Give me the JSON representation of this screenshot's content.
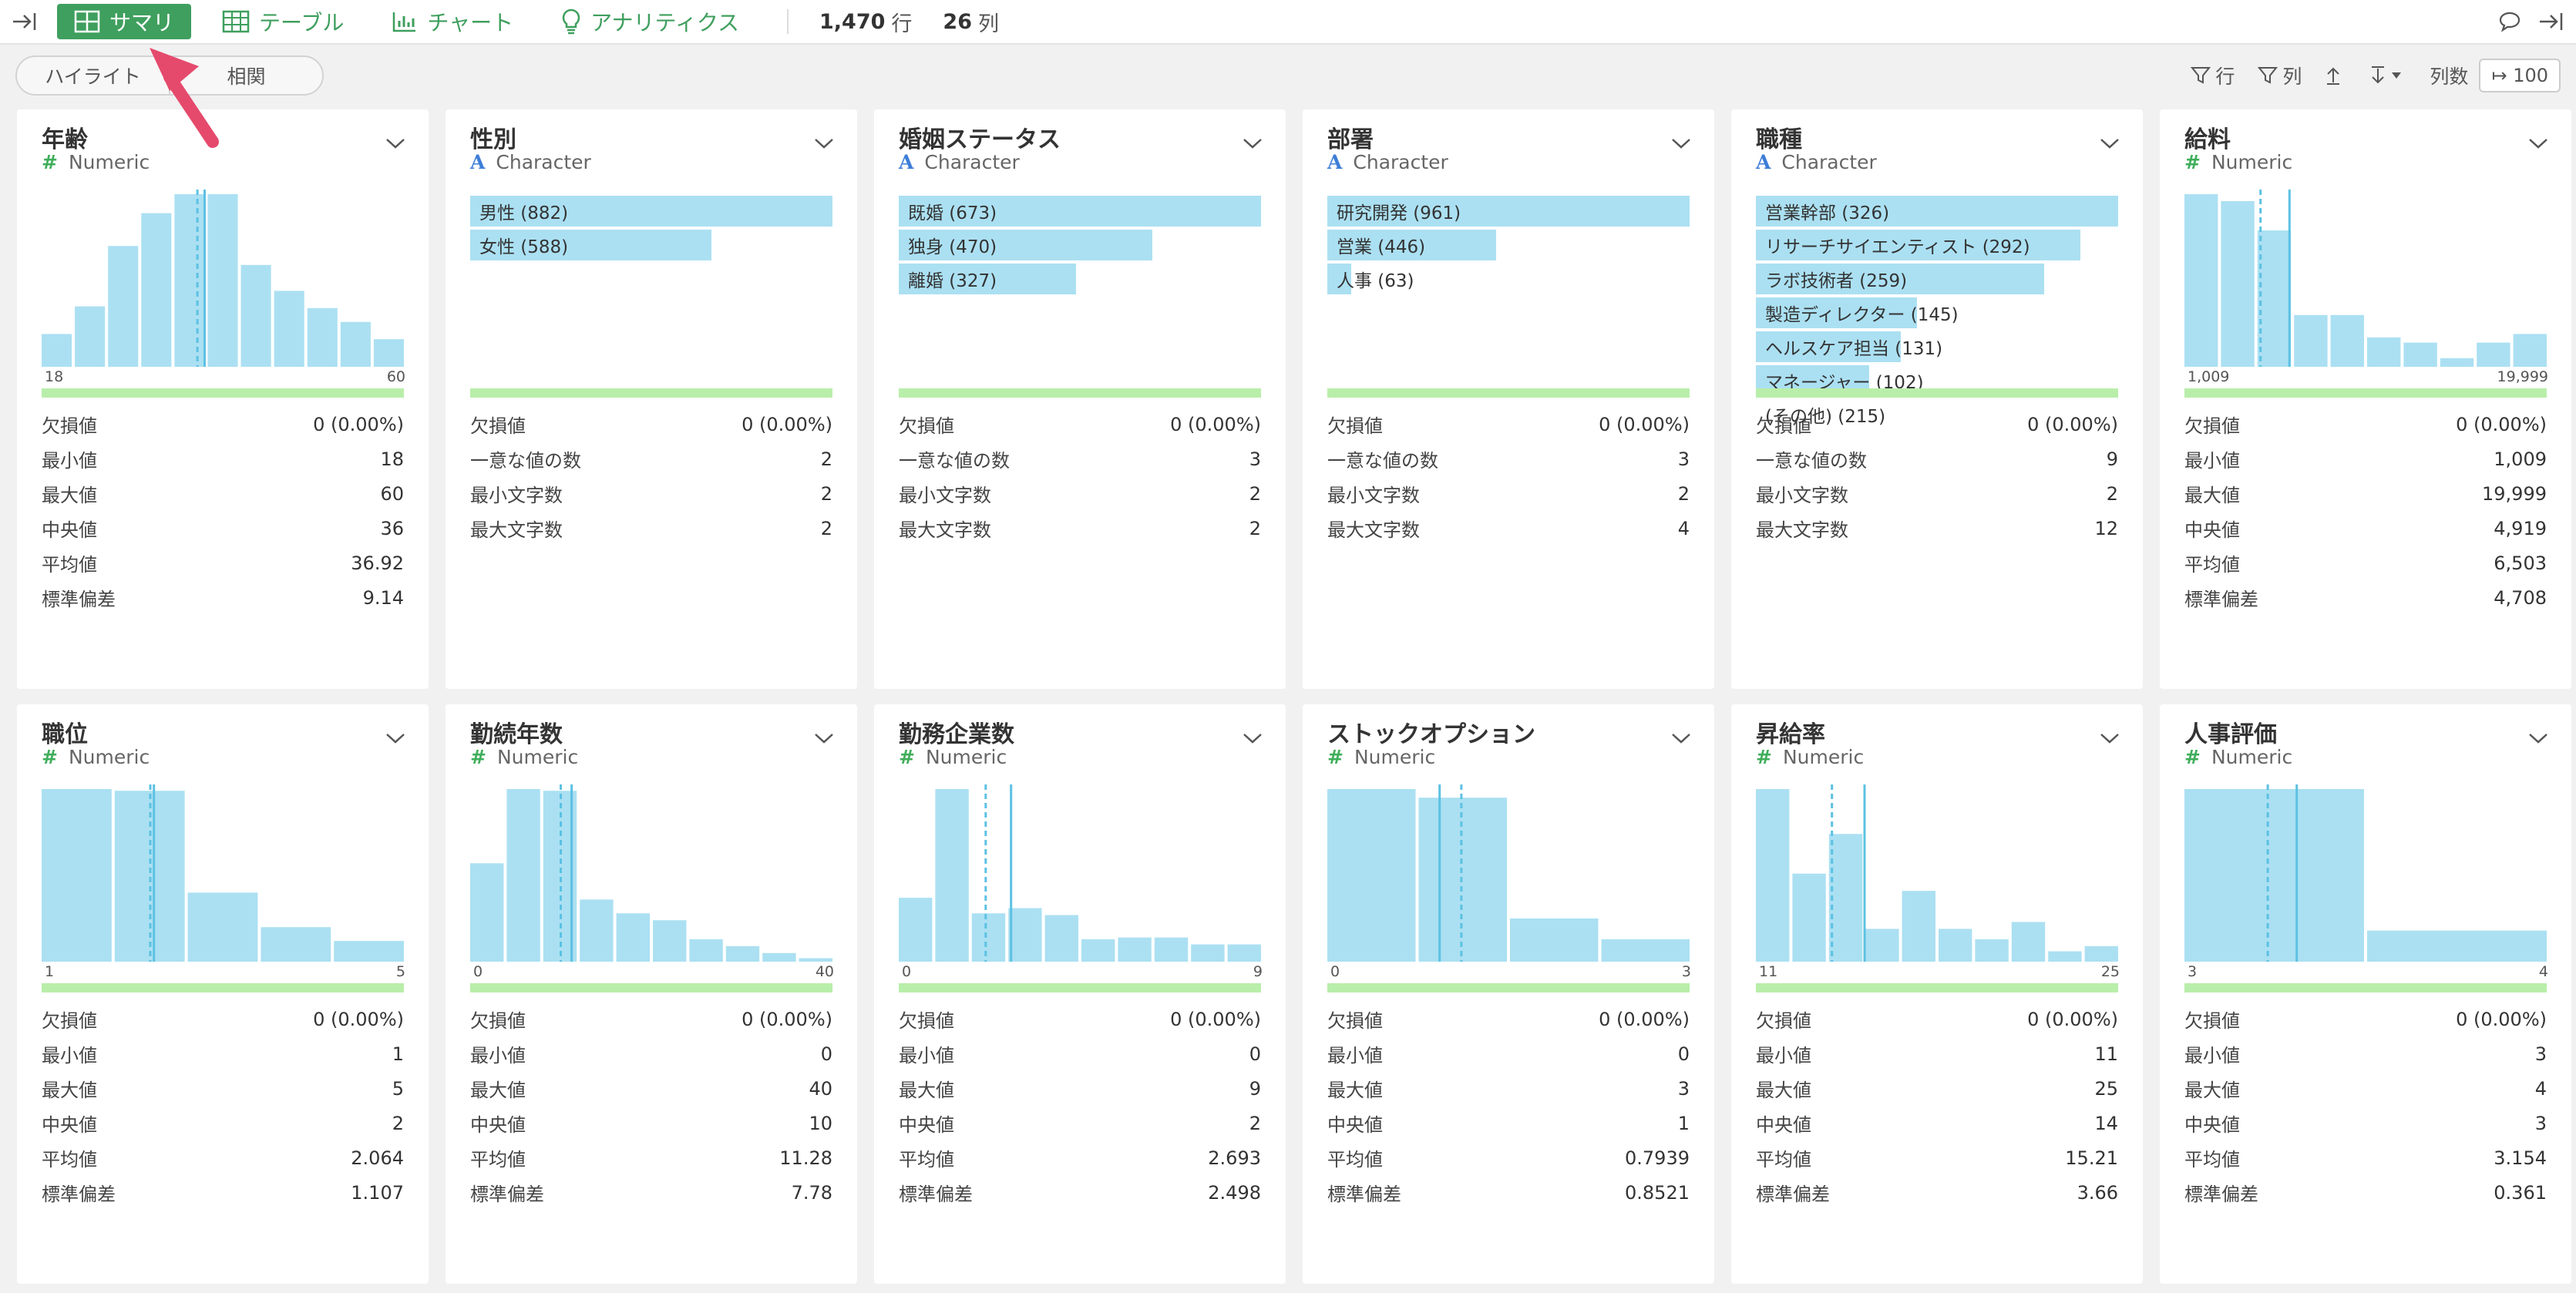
{
  "toolbar": {
    "tabs": [
      {
        "label": "サマリ",
        "icon": "grid-icon",
        "active": true
      },
      {
        "label": "テーブル",
        "icon": "table-icon",
        "active": false
      },
      {
        "label": "チャート",
        "icon": "bar-chart-icon",
        "active": false
      },
      {
        "label": "アナリティクス",
        "icon": "lightbulb-icon",
        "active": false
      }
    ],
    "rows_count": "1,470",
    "rows_unit": "行",
    "cols_count": "26",
    "cols_unit": "列"
  },
  "subbar": {
    "segment": [
      "ハイライト",
      "相関"
    ],
    "row_filter": "行",
    "col_filter": "列",
    "cols_label": "列数",
    "cols_value": "100"
  },
  "colors": {
    "accent": "#3f9f5e",
    "bar": "#abe0f2",
    "line": "#5cc1e3",
    "quality": "#b9eeaa"
  },
  "cards": [
    {
      "title": "年齢",
      "type": "Numeric",
      "kind": "hist",
      "bins": [
        0.19,
        0.35,
        0.7,
        0.89,
        1.0,
        1.0,
        0.59,
        0.44,
        0.34,
        0.26,
        0.16
      ],
      "median_frac": 0.43,
      "mean_frac": 0.45,
      "min_label": "18",
      "max_label": "60",
      "stats": [
        [
          "欠損値",
          "0 (0.00%)"
        ],
        [
          "最小値",
          "18"
        ],
        [
          "最大値",
          "60"
        ],
        [
          "中央値",
          "36"
        ],
        [
          "平均値",
          "36.92"
        ],
        [
          "標準偏差",
          "9.14"
        ]
      ]
    },
    {
      "title": "性別",
      "type": "Character",
      "kind": "list",
      "items": [
        {
          "label": "男性 (882)",
          "frac": 1.0
        },
        {
          "label": "女性 (588)",
          "frac": 0.667
        }
      ],
      "stats": [
        [
          "欠損値",
          "0 (0.00%)"
        ],
        [
          "一意な値の数",
          "2"
        ],
        [
          "最小文字数",
          "2"
        ],
        [
          "最大文字数",
          "2"
        ]
      ]
    },
    {
      "title": "婚姻ステータス",
      "type": "Character",
      "kind": "list",
      "items": [
        {
          "label": "既婚 (673)",
          "frac": 1.0
        },
        {
          "label": "独身 (470)",
          "frac": 0.7
        },
        {
          "label": "離婚 (327)",
          "frac": 0.49
        }
      ],
      "stats": [
        [
          "欠損値",
          "0 (0.00%)"
        ],
        [
          "一意な値の数",
          "3"
        ],
        [
          "最小文字数",
          "2"
        ],
        [
          "最大文字数",
          "2"
        ]
      ]
    },
    {
      "title": "部署",
      "type": "Character",
      "kind": "list",
      "items": [
        {
          "label": "研究開発 (961)",
          "frac": 1.0
        },
        {
          "label": "営業 (446)",
          "frac": 0.465
        },
        {
          "label": "人事 (63)",
          "frac": 0.065
        }
      ],
      "stats": [
        [
          "欠損値",
          "0 (0.00%)"
        ],
        [
          "一意な値の数",
          "3"
        ],
        [
          "最小文字数",
          "2"
        ],
        [
          "最大文字数",
          "4"
        ]
      ]
    },
    {
      "title": "職種",
      "type": "Character",
      "kind": "list",
      "items": [
        {
          "label": "営業幹部 (326)",
          "frac": 1.0
        },
        {
          "label": "リサーチサイエンティスト (292)",
          "frac": 0.895
        },
        {
          "label": "ラボ技術者 (259)",
          "frac": 0.795
        },
        {
          "label": "製造ディレクター (145)",
          "frac": 0.445
        },
        {
          "label": "ヘルスケア担当 (131)",
          "frac": 0.4
        },
        {
          "label": "マネージャー (102)",
          "frac": 0.313
        },
        {
          "label": "(その他) (215)",
          "frac": 0
        }
      ],
      "stats": [
        [
          "欠損値",
          "0 (0.00%)"
        ],
        [
          "一意な値の数",
          "9"
        ],
        [
          "最小文字数",
          "2"
        ],
        [
          "最大文字数",
          "12"
        ]
      ]
    },
    {
      "title": "給料",
      "type": "Numeric",
      "kind": "hist",
      "bins": [
        1.0,
        0.96,
        0.79,
        0.3,
        0.3,
        0.17,
        0.14,
        0.05,
        0.14,
        0.19
      ],
      "median_frac": 0.21,
      "mean_frac": 0.29,
      "min_label": "1,009",
      "max_label": "19,999",
      "stats": [
        [
          "欠損値",
          "0 (0.00%)"
        ],
        [
          "最小値",
          "1,009"
        ],
        [
          "最大値",
          "19,999"
        ],
        [
          "中央値",
          "4,919"
        ],
        [
          "平均値",
          "6,503"
        ],
        [
          "標準偏差",
          "4,708"
        ]
      ]
    },
    {
      "title": "職位",
      "type": "Numeric",
      "kind": "hist",
      "bins": [
        1.0,
        0.99,
        0.4,
        0.2,
        0.12
      ],
      "median_frac": 0.3,
      "mean_frac": 0.31,
      "min_label": "1",
      "max_label": "5",
      "stats": [
        [
          "欠損値",
          "0 (0.00%)"
        ],
        [
          "最小値",
          "1"
        ],
        [
          "最大値",
          "5"
        ],
        [
          "中央値",
          "2"
        ],
        [
          "平均値",
          "2.064"
        ],
        [
          "標準偏差",
          "1.107"
        ]
      ]
    },
    {
      "title": "勤続年数",
      "type": "Numeric",
      "kind": "hist",
      "bins": [
        0.57,
        1.0,
        0.99,
        0.36,
        0.28,
        0.24,
        0.13,
        0.09,
        0.05,
        0.02
      ],
      "median_frac": 0.25,
      "mean_frac": 0.28,
      "min_label": "0",
      "max_label": "40",
      "stats": [
        [
          "欠損値",
          "0 (0.00%)"
        ],
        [
          "最小値",
          "0"
        ],
        [
          "最大値",
          "40"
        ],
        [
          "中央値",
          "10"
        ],
        [
          "平均値",
          "11.28"
        ],
        [
          "標準偏差",
          "7.78"
        ]
      ]
    },
    {
      "title": "勤務企業数",
      "type": "Numeric",
      "kind": "hist",
      "bins": [
        0.37,
        1.0,
        0.28,
        0.31,
        0.27,
        0.13,
        0.14,
        0.14,
        0.1,
        0.1
      ],
      "median_frac": 0.24,
      "mean_frac": 0.31,
      "min_label": "0",
      "max_label": "9",
      "stats": [
        [
          "欠損値",
          "0 (0.00%)"
        ],
        [
          "最小値",
          "0"
        ],
        [
          "最大値",
          "9"
        ],
        [
          "中央値",
          "2"
        ],
        [
          "平均値",
          "2.693"
        ],
        [
          "標準偏差",
          "2.498"
        ]
      ]
    },
    {
      "title": "ストックオプション",
      "type": "Numeric",
      "kind": "hist",
      "bins": [
        1.0,
        0.95,
        0.25,
        0.13
      ],
      "median_frac": 0.37,
      "mean_frac": 0.31,
      "min_label": "0",
      "max_label": "3",
      "stats": [
        [
          "欠損値",
          "0 (0.00%)"
        ],
        [
          "最小値",
          "0"
        ],
        [
          "最大値",
          "3"
        ],
        [
          "中央値",
          "1"
        ],
        [
          "平均値",
          "0.7939"
        ],
        [
          "標準偏差",
          "0.8521"
        ]
      ]
    },
    {
      "title": "昇給率",
      "type": "Numeric",
      "kind": "hist",
      "bins": [
        1.0,
        0.51,
        0.74,
        0.19,
        0.41,
        0.19,
        0.13,
        0.23,
        0.06,
        0.09
      ],
      "median_frac": 0.21,
      "mean_frac": 0.3,
      "min_label": "11",
      "max_label": "25",
      "stats": [
        [
          "欠損値",
          "0 (0.00%)"
        ],
        [
          "最小値",
          "11"
        ],
        [
          "最大値",
          "25"
        ],
        [
          "中央値",
          "14"
        ],
        [
          "平均値",
          "15.21"
        ],
        [
          "標準偏差",
          "3.66"
        ]
      ]
    },
    {
      "title": "人事評価",
      "type": "Numeric",
      "kind": "hist",
      "bins": [
        1.0,
        0.18
      ],
      "median_frac": 0.23,
      "mean_frac": 0.31,
      "min_label": "3",
      "max_label": "4",
      "stats": [
        [
          "欠損値",
          "0 (0.00%)"
        ],
        [
          "最小値",
          "3"
        ],
        [
          "最大値",
          "4"
        ],
        [
          "中央値",
          "3"
        ],
        [
          "平均値",
          "3.154"
        ],
        [
          "標準偏差",
          "0.361"
        ]
      ]
    }
  ]
}
